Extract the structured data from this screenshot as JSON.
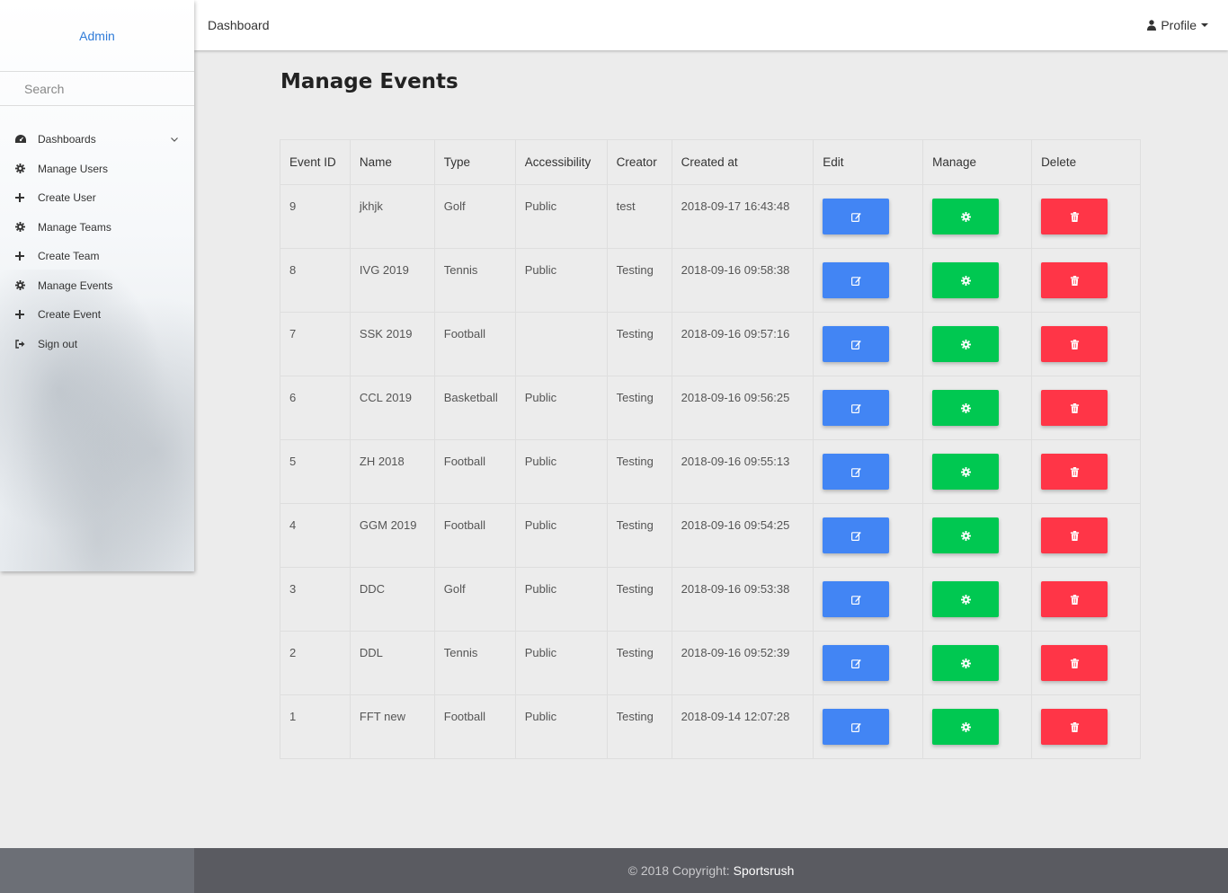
{
  "sidebar": {
    "brand": "Admin",
    "search_placeholder": "Search",
    "items": [
      {
        "label": "Dashboards",
        "icon": "dashboard-icon",
        "expandable": true
      },
      {
        "label": "Manage Users",
        "icon": "gear-icon"
      },
      {
        "label": "Create User",
        "icon": "plus-icon"
      },
      {
        "label": "Manage Teams",
        "icon": "gear-icon"
      },
      {
        "label": "Create Team",
        "icon": "plus-icon"
      },
      {
        "label": "Manage Events",
        "icon": "gear-icon"
      },
      {
        "label": "Create Event",
        "icon": "plus-icon"
      },
      {
        "label": "Sign out",
        "icon": "sign-out-icon"
      }
    ]
  },
  "header": {
    "title": "Dashboard",
    "profile_label": "Profile"
  },
  "main": {
    "title": "Manage Events",
    "columns": [
      "Event ID",
      "Name",
      "Type",
      "Accessibility",
      "Creator",
      "Created at",
      "Edit",
      "Manage",
      "Delete"
    ],
    "rows": [
      {
        "id": "9",
        "name": "jkhjk",
        "type": "Golf",
        "accessibility": "Public",
        "creator": "test",
        "created_at": "2018-09-17 16:43:48"
      },
      {
        "id": "8",
        "name": "IVG 2019",
        "type": "Tennis",
        "accessibility": "Public",
        "creator": "Testing",
        "created_at": "2018-09-16 09:58:38"
      },
      {
        "id": "7",
        "name": "SSK 2019",
        "type": "Football",
        "accessibility": "",
        "creator": "Testing",
        "created_at": "2018-09-16 09:57:16"
      },
      {
        "id": "6",
        "name": "CCL 2019",
        "type": "Basketball",
        "accessibility": "Public",
        "creator": "Testing",
        "created_at": "2018-09-16 09:56:25"
      },
      {
        "id": "5",
        "name": "ZH 2018",
        "type": "Football",
        "accessibility": "Public",
        "creator": "Testing",
        "created_at": "2018-09-16 09:55:13"
      },
      {
        "id": "4",
        "name": "GGM 2019",
        "type": "Football",
        "accessibility": "Public",
        "creator": "Testing",
        "created_at": "2018-09-16 09:54:25"
      },
      {
        "id": "3",
        "name": "DDC",
        "type": "Golf",
        "accessibility": "Public",
        "creator": "Testing",
        "created_at": "2018-09-16 09:53:38"
      },
      {
        "id": "2",
        "name": "DDL",
        "type": "Tennis",
        "accessibility": "Public",
        "creator": "Testing",
        "created_at": "2018-09-16 09:52:39"
      },
      {
        "id": "1",
        "name": "FFT new",
        "type": "Football",
        "accessibility": "Public",
        "creator": "Testing",
        "created_at": "2018-09-14 12:07:28"
      }
    ],
    "actions": {
      "edit_icon": "edit-icon",
      "manage_icon": "gear-icon",
      "delete_icon": "trash-icon"
    }
  },
  "footer": {
    "copyright": "© 2018 Copyright:",
    "brand": "Sportsrush"
  },
  "colors": {
    "accent_blue": "#4285f4",
    "success_green": "#00c851",
    "danger_red": "#ff3547",
    "brand_link": "#2f7bd8",
    "footer_bg": "#5a5b61"
  }
}
